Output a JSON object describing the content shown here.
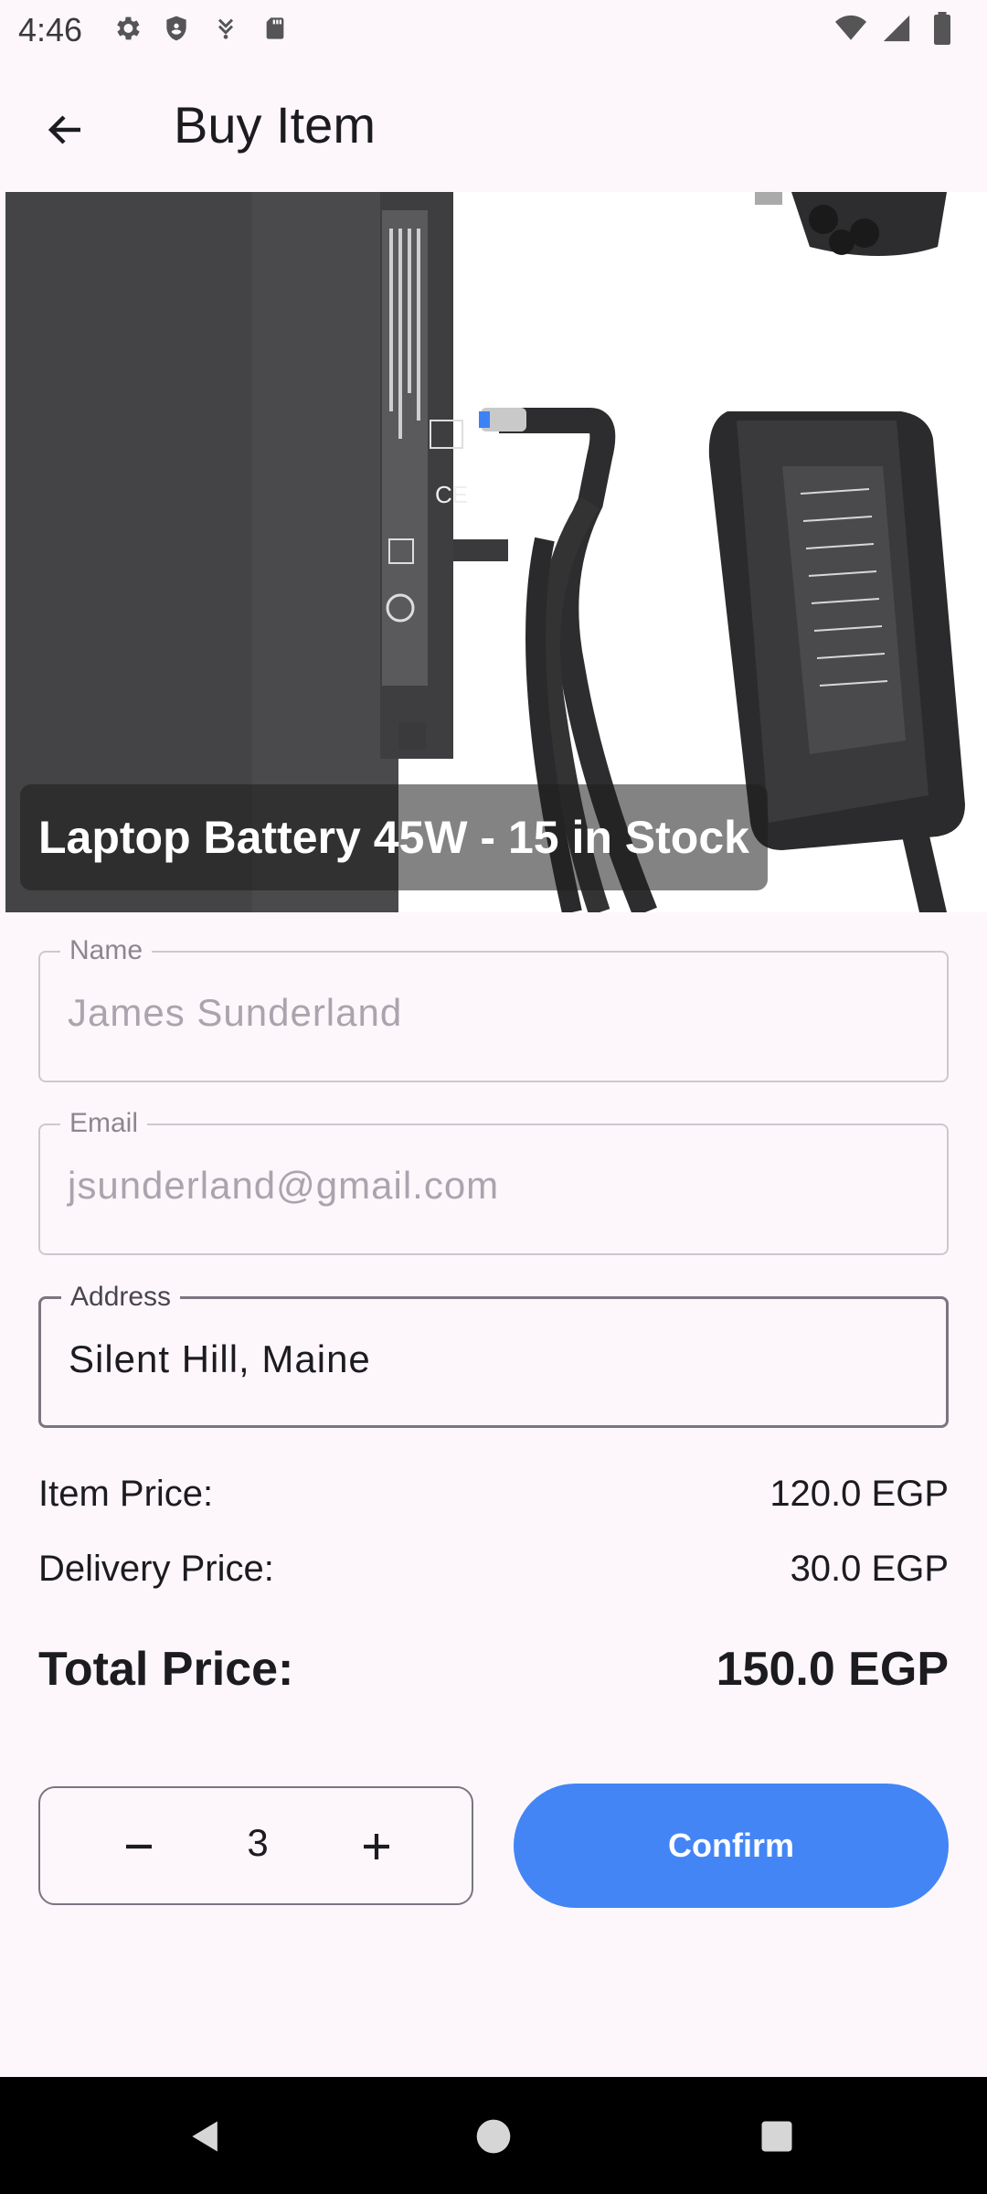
{
  "status_bar": {
    "time": "4:46",
    "left_icons": [
      "settings-icon",
      "shield-icon",
      "download-icon",
      "sd-card-icon"
    ],
    "right_icons": [
      "wifi-icon",
      "signal-icon",
      "battery-icon"
    ]
  },
  "app_bar": {
    "title": "Buy Item",
    "back_icon": "arrow-back-icon"
  },
  "product": {
    "caption": "Laptop Battery 45W - 15 in Stock",
    "image_alt": "laptop battery and charger adapter"
  },
  "form": {
    "name": {
      "label": "Name",
      "value": "James Sunderland"
    },
    "email": {
      "label": "Email",
      "value": "jsunderland@gmail.com"
    },
    "address": {
      "label": "Address",
      "value": "Silent Hill, Maine"
    }
  },
  "prices": {
    "item_label": "Item Price:",
    "item_value": "120.0 EGP",
    "delivery_label": "Delivery Price:",
    "delivery_value": "30.0 EGP",
    "total_label": "Total Price:",
    "total_value": "150.0 EGP"
  },
  "quantity": {
    "value": "3"
  },
  "actions": {
    "confirm_label": "Confirm"
  },
  "colors": {
    "background": "#fdf7fc",
    "accent": "#4385f5",
    "nav_bar": "#000000"
  }
}
